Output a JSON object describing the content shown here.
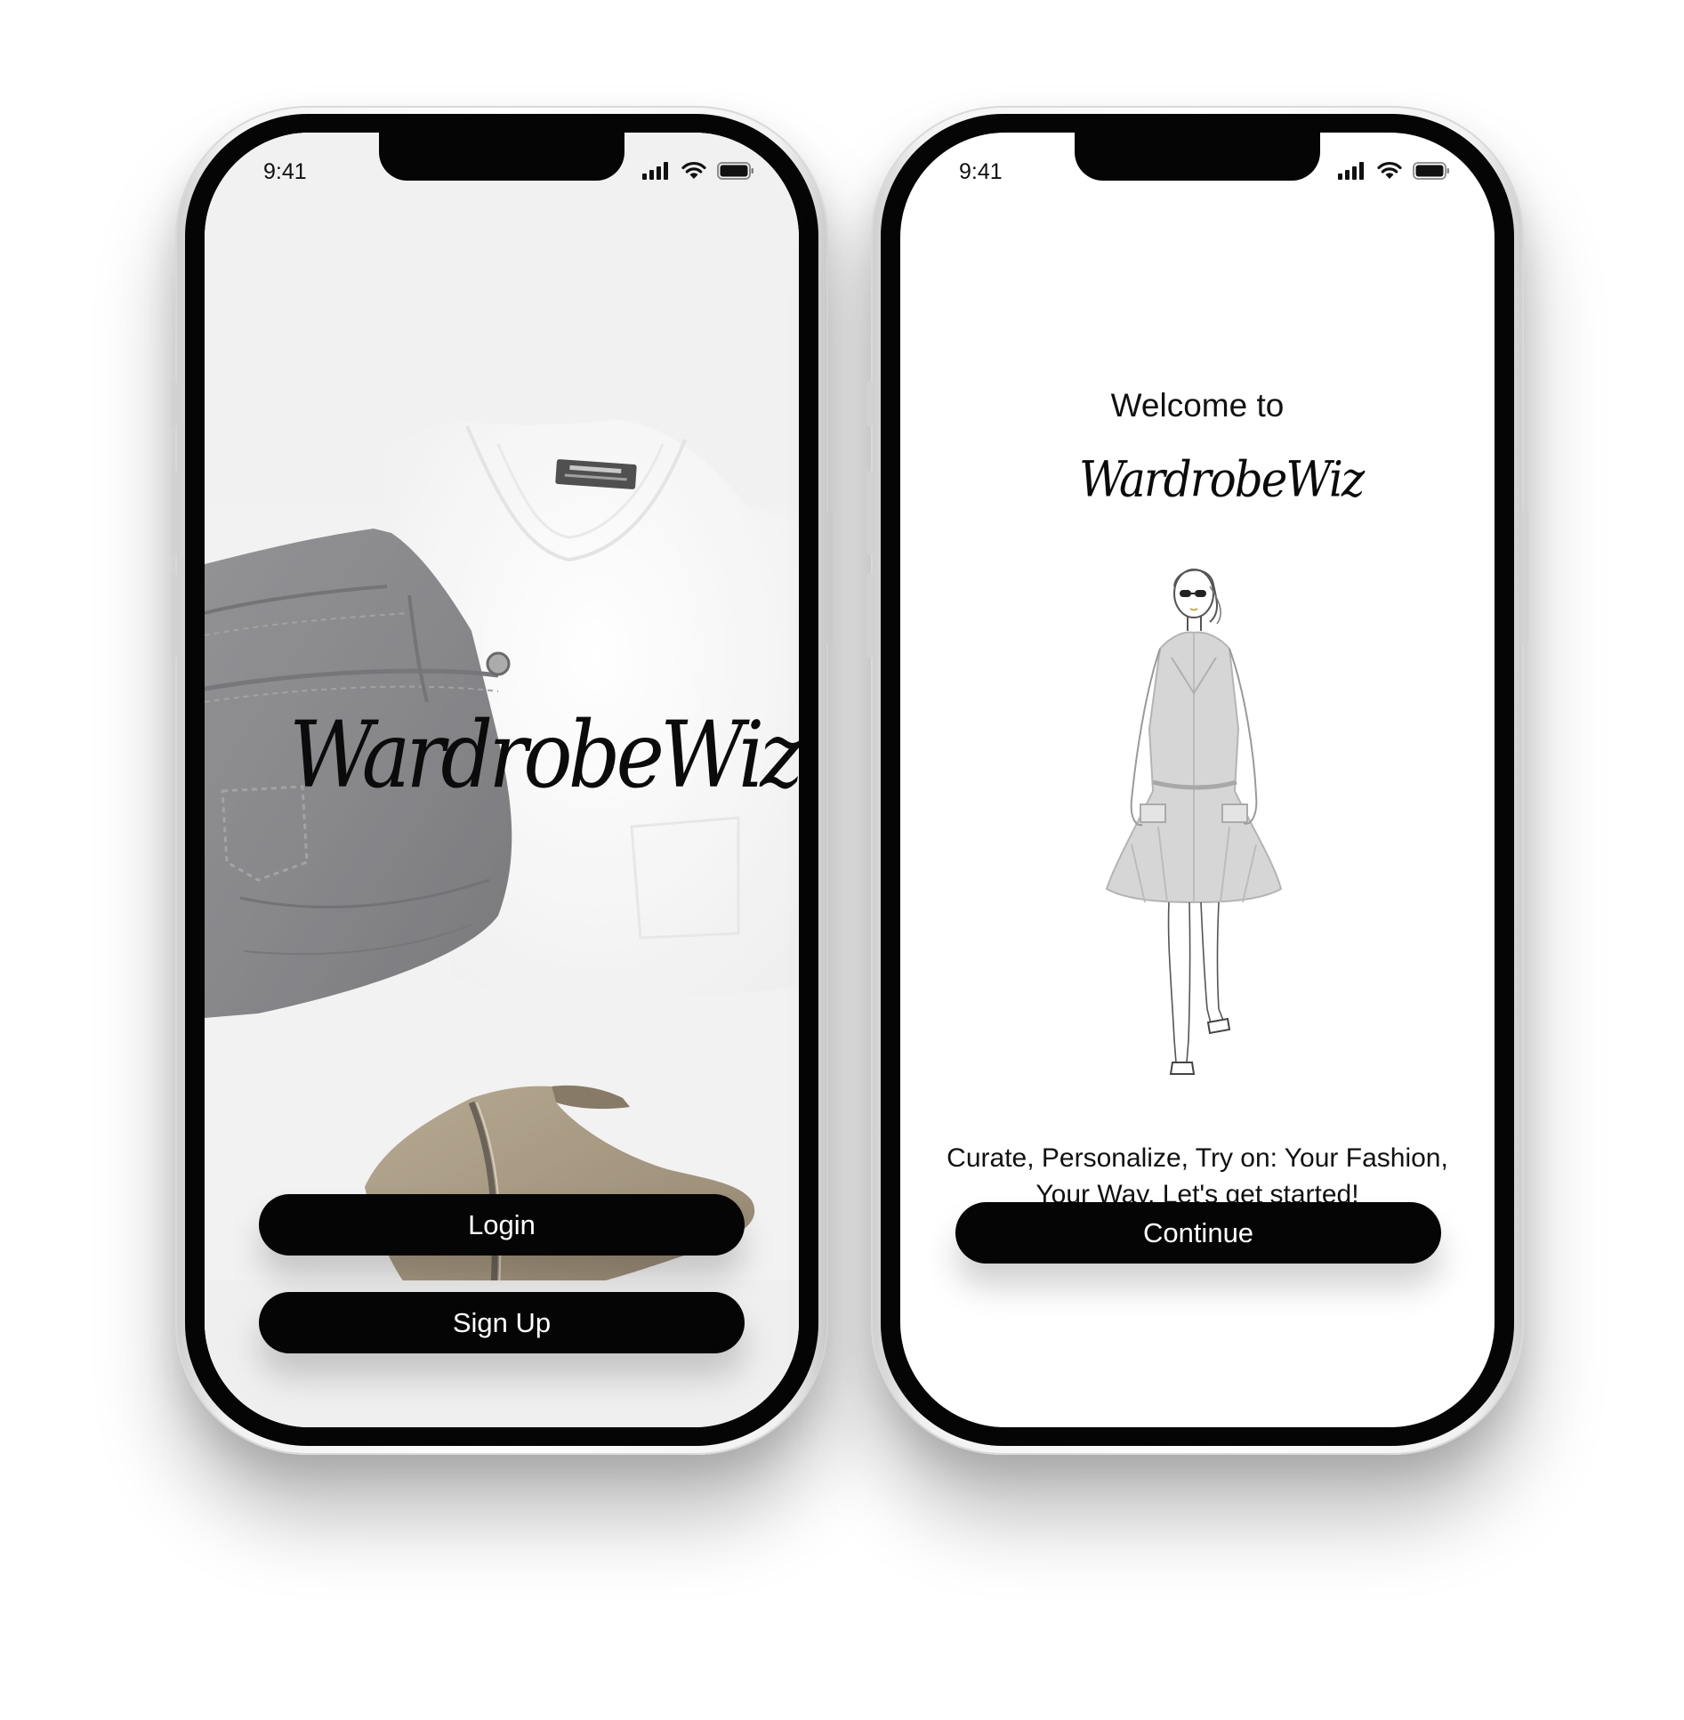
{
  "status_bar": {
    "time": "9:41"
  },
  "login_screen": {
    "logo": "WardrobeWiz",
    "login_label": "Login",
    "signup_label": "Sign Up"
  },
  "welcome_screen": {
    "heading": "Welcome to",
    "logo": "WardrobeWiz",
    "tagline_line1": "Curate, Personalize, Try on: Your Fashion,",
    "tagline_line2": "Your Way. Let's get started!",
    "continue_label": "Continue"
  },
  "icons": [
    "signal-icon",
    "wifi-icon",
    "battery-icon",
    "clothing-photo",
    "fashion-figure-illustration"
  ],
  "colors": {
    "button": "#050505",
    "button_text": "#ffffff",
    "login_background": "#efeff0",
    "welcome_background": "#ffffff"
  }
}
